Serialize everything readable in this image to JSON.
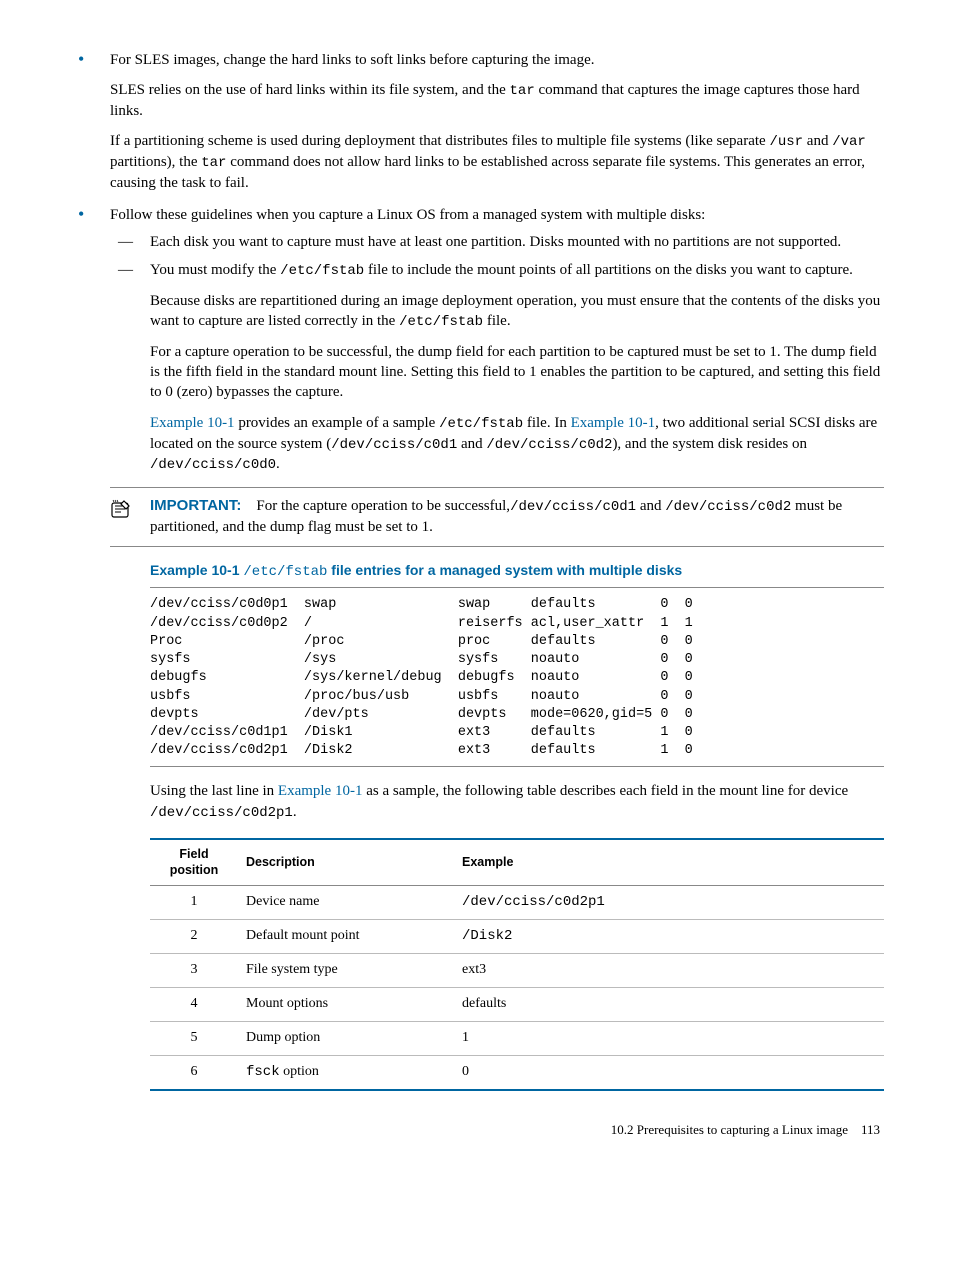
{
  "bullets": {
    "sles_intro": "For SLES images, change the hard links to soft links before capturing the image.",
    "sles_p1_a": "SLES relies on the use of hard links within its file system, and the ",
    "sles_p1_tar": "tar",
    "sles_p1_b": " command that captures the image captures those hard links.",
    "sles_p2_a": "If a partitioning scheme is used during deployment that distributes files to multiple file systems (like separate ",
    "sles_p2_usr": "/usr",
    "sles_p2_b": " and ",
    "sles_p2_var": "/var",
    "sles_p2_c": " partitions), the ",
    "sles_p2_tar": "tar",
    "sles_p2_d": " command does not allow hard links to be established across separate file systems. This generates an error, causing the task to fail.",
    "multi_intro": "Follow these guidelines when you capture a Linux OS from a managed system with multiple disks:",
    "dash1": "Each disk you want to capture must have at least one partition. Disks mounted with no partitions are not supported.",
    "dash2_a": "You must modify the ",
    "dash2_path": "/etc/fstab",
    "dash2_b": " file to include the mount points of all partitions on the disks you want to capture.",
    "dash2_p1_a": "Because disks are repartitioned during an image deployment operation, you must ensure that the contents of the disks you want to capture are listed correctly in the ",
    "dash2_p1_path": "/etc/fstab",
    "dash2_p1_b": " file.",
    "dash2_p2": "For a capture operation to be successful, the dump field for each partition to be captured must be set to 1. The dump field is the fifth field in the standard mount line. Setting this field to 1 enables the partition to be captured, and setting this field to 0 (zero) bypasses the capture.",
    "dash2_p3_link1": "Example 10-1",
    "dash2_p3_a": " provides an example of a sample ",
    "dash2_p3_path1": "/etc/fstab",
    "dash2_p3_b": " file. In ",
    "dash2_p3_link2": "Example 10-1",
    "dash2_p3_c": ", two additional serial SCSI disks are located on the source system (",
    "dash2_p3_path2": "/dev/cciss/c0d1",
    "dash2_p3_d": " and ",
    "dash2_p3_path3": "/dev/cciss/c0d2",
    "dash2_p3_e": "), and the system disk resides on ",
    "dash2_p3_path4": "/dev/cciss/c0d0",
    "dash2_p3_f": "."
  },
  "important": {
    "label": "IMPORTANT:",
    "a": "For the capture operation to be successful,",
    "path1": "/dev/cciss/c0d1",
    "b": " and ",
    "path2": "/dev/cciss/c0d2",
    "c": " must be partitioned, and the dump flag must be set to 1."
  },
  "example": {
    "title_a": "Example 10-1 ",
    "title_path": "/etc/fstab",
    "title_b": " file entries for a managed system with multiple disks",
    "fstab": "/dev/cciss/c0d0p1  swap               swap     defaults        0  0\n/dev/cciss/c0d0p2  /                  reiserfs acl,user_xattr  1  1\nProc               /proc              proc     defaults        0  0\nsysfs              /sys               sysfs    noauto          0  0\ndebugfs            /sys/kernel/debug  debugfs  noauto          0  0\nusbfs              /proc/bus/usb      usbfs    noauto          0  0\ndevpts             /dev/pts           devpts   mode=0620,gid=5 0  0\n/dev/cciss/c0d1p1  /Disk1             ext3     defaults        1  0\n/dev/cciss/c0d2p1  /Disk2             ext3     defaults        1  0"
  },
  "after_example": {
    "a": "Using the last line in ",
    "link": "Example 10-1",
    "b": " as a sample, the following table describes each field in the mount line for device ",
    "path": "/dev/cciss/c0d2p1",
    "c": "."
  },
  "table": {
    "headers": {
      "pos": "Field position",
      "desc": "Description",
      "ex": "Example"
    },
    "rows": [
      {
        "pos": "1",
        "desc_plain": "Device name",
        "ex_mono": "/dev/cciss/c0d2p1"
      },
      {
        "pos": "2",
        "desc_plain": "Default mount point",
        "ex_mono": "/Disk2"
      },
      {
        "pos": "3",
        "desc_plain": "File system type",
        "ex_plain": "ext3"
      },
      {
        "pos": "4",
        "desc_plain": "Mount options",
        "ex_plain": "defaults"
      },
      {
        "pos": "5",
        "desc_plain": "Dump option",
        "ex_plain": "1"
      },
      {
        "pos": "6",
        "desc_mono": "fsck",
        "desc_suffix": " option",
        "ex_plain": "0"
      }
    ]
  },
  "footer": {
    "section": "10.2 Prerequisites to capturing a Linux image",
    "page": "113"
  }
}
